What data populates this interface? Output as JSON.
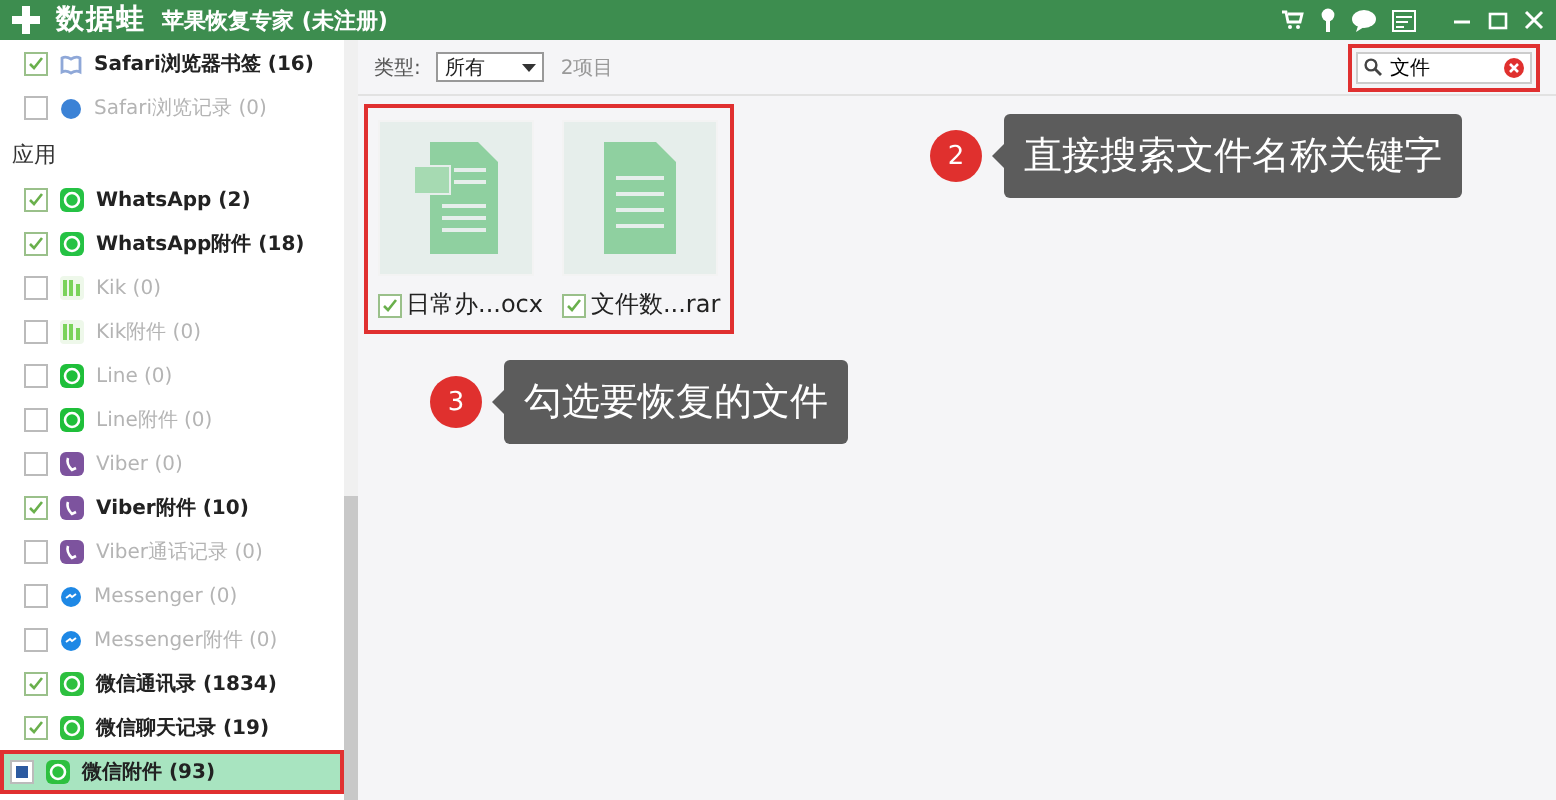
{
  "window": {
    "brand": "数据蛙",
    "title": "苹果恢复专家 (未注册)"
  },
  "sidebar": {
    "items": [
      {
        "kind": "bookmark",
        "label": "Safari浏览器书签 (16)",
        "checked": true,
        "partial": false,
        "dimmed": false,
        "selected": false,
        "color": "#8fa8d8"
      },
      {
        "kind": "history",
        "label": "Safari浏览记录 (0)",
        "checked": false,
        "partial": false,
        "dimmed": true,
        "selected": false,
        "color": "#3b82d6"
      },
      {
        "kind": "heading",
        "label": "应用"
      },
      {
        "kind": "chat",
        "label": "WhatsApp (2)",
        "checked": true,
        "partial": false,
        "dimmed": false,
        "selected": false,
        "color": "#25c244"
      },
      {
        "kind": "chat",
        "label": "WhatsApp附件 (18)",
        "checked": true,
        "partial": false,
        "dimmed": false,
        "selected": false,
        "color": "#25c244"
      },
      {
        "kind": "kik",
        "label": "Kik (0)",
        "checked": false,
        "partial": false,
        "dimmed": true,
        "selected": false,
        "color": "#7ad35a"
      },
      {
        "kind": "kik",
        "label": "Kik附件 (0)",
        "checked": false,
        "partial": false,
        "dimmed": true,
        "selected": false,
        "color": "#7ad35a"
      },
      {
        "kind": "chat",
        "label": "Line (0)",
        "checked": false,
        "partial": false,
        "dimmed": true,
        "selected": false,
        "color": "#1fbf3a"
      },
      {
        "kind": "chat",
        "label": "Line附件 (0)",
        "checked": false,
        "partial": false,
        "dimmed": true,
        "selected": false,
        "color": "#1fbf3a"
      },
      {
        "kind": "phone",
        "label": "Viber (0)",
        "checked": false,
        "partial": false,
        "dimmed": true,
        "selected": false,
        "color": "#7d539e"
      },
      {
        "kind": "phone",
        "label": "Viber附件 (10)",
        "checked": true,
        "partial": false,
        "dimmed": false,
        "selected": false,
        "color": "#7d539e"
      },
      {
        "kind": "phone",
        "label": "Viber通话记录 (0)",
        "checked": false,
        "partial": false,
        "dimmed": true,
        "selected": false,
        "color": "#7d539e"
      },
      {
        "kind": "bubble",
        "label": "Messenger (0)",
        "checked": false,
        "partial": false,
        "dimmed": true,
        "selected": false,
        "color": "#1e88e5"
      },
      {
        "kind": "bubble",
        "label": "Messenger附件 (0)",
        "checked": false,
        "partial": false,
        "dimmed": true,
        "selected": false,
        "color": "#1e88e5"
      },
      {
        "kind": "chat",
        "label": "微信通讯录 (1834)",
        "checked": true,
        "partial": false,
        "dimmed": false,
        "selected": false,
        "color": "#2dc03f"
      },
      {
        "kind": "chat",
        "label": "微信聊天记录 (19)",
        "checked": true,
        "partial": false,
        "dimmed": false,
        "selected": false,
        "color": "#2dc03f"
      },
      {
        "kind": "chat",
        "label": "微信附件 (93)",
        "checked": false,
        "partial": true,
        "dimmed": false,
        "selected": true,
        "color": "#2dc03f"
      }
    ]
  },
  "toolbar": {
    "type_label": "类型:",
    "type_value": "所有",
    "count": "2项目",
    "search": {
      "value": "文件"
    }
  },
  "files": [
    {
      "kind": "doc",
      "name": "日常办...ocx",
      "checked": true
    },
    {
      "kind": "text",
      "name": "文件数...rar",
      "checked": true
    }
  ],
  "callouts": [
    {
      "number": "2",
      "text": "直接搜索文件名称关键字"
    },
    {
      "number": "3",
      "text": "勾选要恢复的文件"
    }
  ]
}
